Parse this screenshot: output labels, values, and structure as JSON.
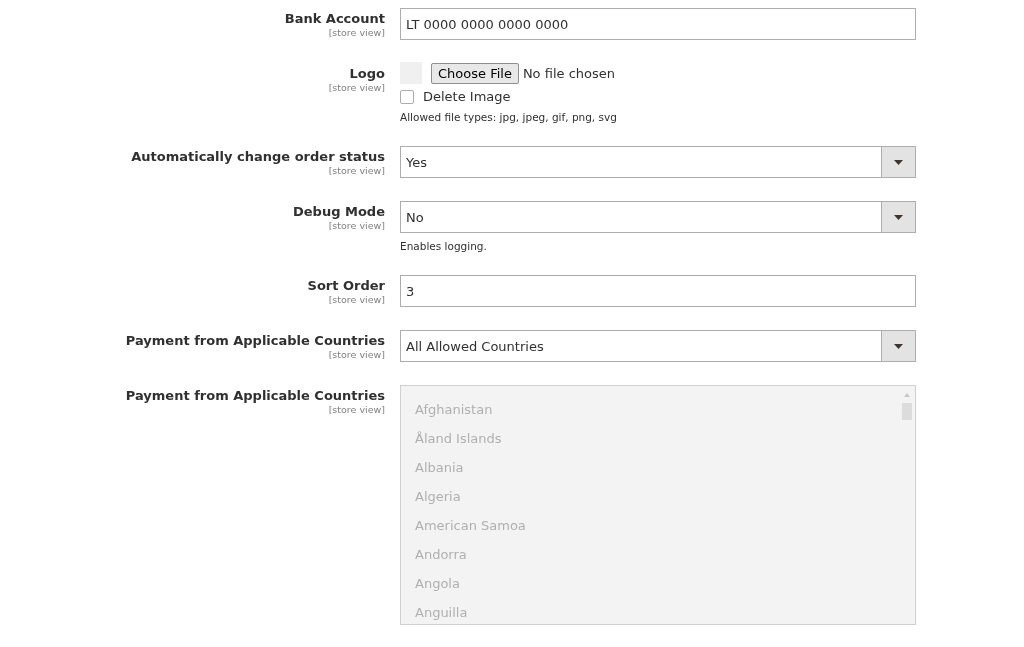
{
  "fields": [
    {
      "kind": "text",
      "label": "Bank Account",
      "scope": "[store view]",
      "value": "LT 0000 0000 0000 0000"
    },
    {
      "kind": "file",
      "label": "Logo",
      "scope": "[store view]",
      "button": "Choose File",
      "file_status": "No file chosen",
      "delete": {
        "label": "Delete Image",
        "checked": false
      },
      "note": "Allowed file types: jpg, jpeg, gif, png, svg"
    },
    {
      "kind": "select",
      "label": "Automatically change order status",
      "scope": "[store view]",
      "value": "Yes"
    },
    {
      "kind": "select",
      "label": "Debug Mode",
      "scope": "[store view]",
      "value": "No",
      "note": "Enables logging."
    },
    {
      "kind": "text",
      "label": "Sort Order",
      "scope": "[store view]",
      "value": "3"
    },
    {
      "kind": "select",
      "label": "Payment from Applicable Countries",
      "scope": "[store view]",
      "value": "All Allowed Countries"
    },
    {
      "kind": "multiselect",
      "label": "Payment from Applicable Countries",
      "scope": "[store view]",
      "disabled": true,
      "options": [
        "Afghanistan",
        "Åland Islands",
        "Albania",
        "Algeria",
        "American Samoa",
        "Andorra",
        "Angola",
        "Anguilla"
      ]
    }
  ]
}
